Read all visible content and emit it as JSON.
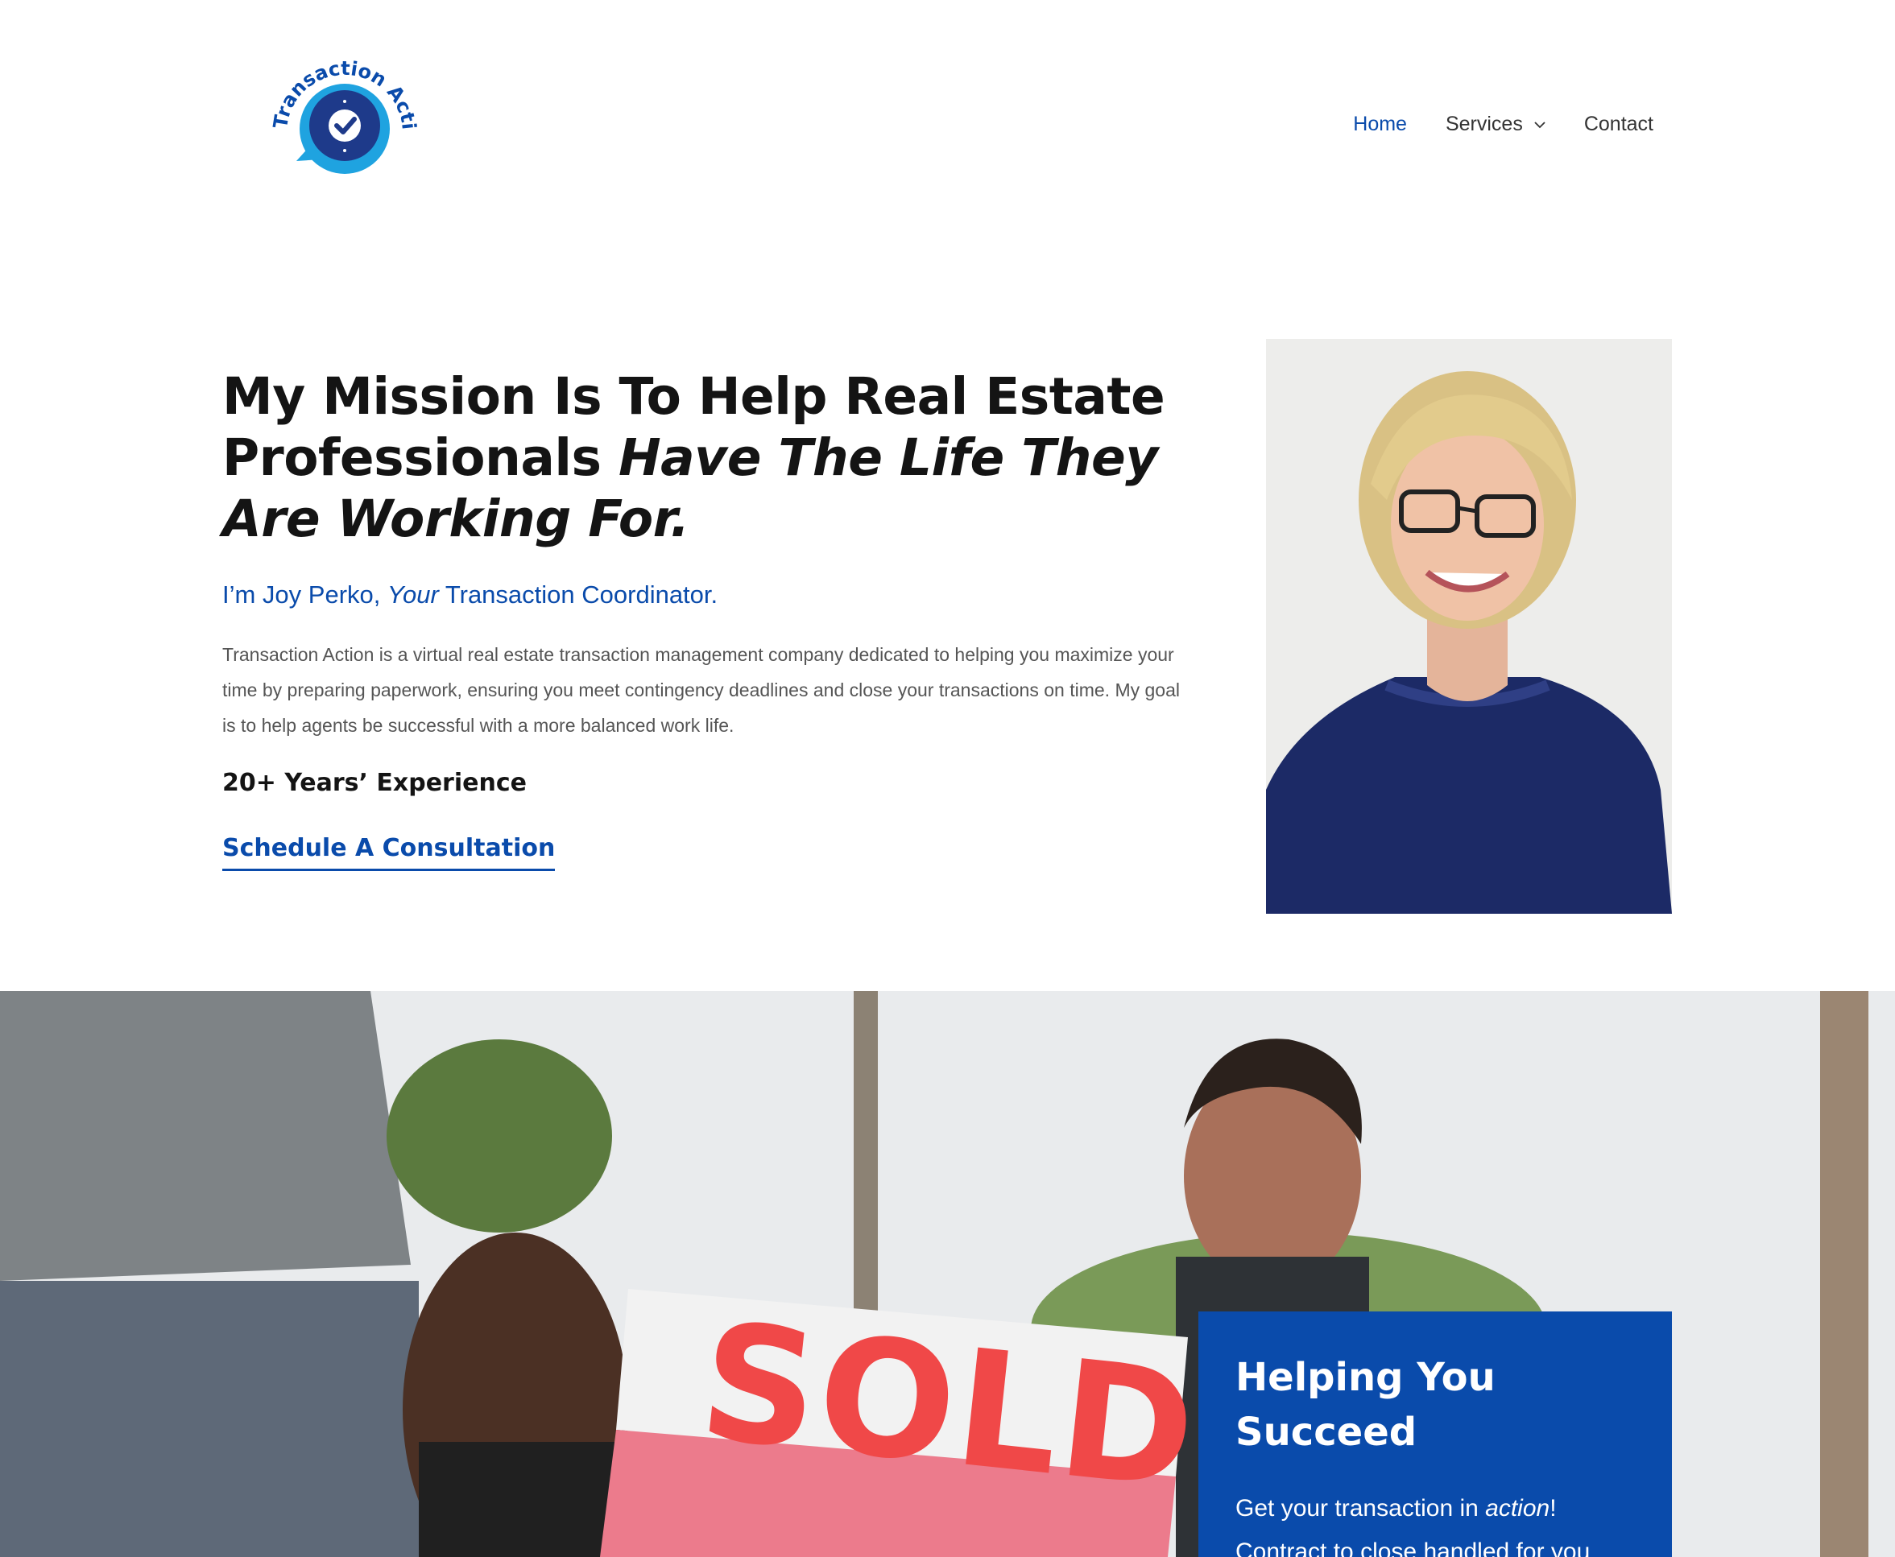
{
  "brand": {
    "logo_text": "Transaction Action",
    "colors": {
      "primary": "#0a4bab",
      "light_blue": "#1fa3e0",
      "dark": "#141414"
    }
  },
  "nav": {
    "items": [
      {
        "label": "Home",
        "active": true
      },
      {
        "label": "Services",
        "has_dropdown": true
      },
      {
        "label": "Contact"
      }
    ]
  },
  "hero": {
    "heading_part1": "My Mission Is To Help Real Estate Professionals ",
    "heading_italic": "Have The Life They Are Working For.",
    "subhead_part1": "I’m Joy Perko, ",
    "subhead_italic": "Your",
    "subhead_part2": " Transaction Coordinator.",
    "description": "Transaction Action is a virtual real estate transaction management company dedicated to helping you maximize your time by preparing paperwork, ensuring you meet contingency deadlines and close your transactions on time. My goal is to help agents be successful with a more balanced work life.",
    "experience": "20+ Years’ Experience",
    "cta_label": "Schedule A Consultation"
  },
  "banner": {
    "sign_text": "SOLD",
    "card_title": "Helping You Succeed",
    "card_text_part1": "Get your transaction in ",
    "card_text_italic": "action",
    "card_text_part2": "!",
    "card_text_line2": "Contract to close handled for you"
  }
}
